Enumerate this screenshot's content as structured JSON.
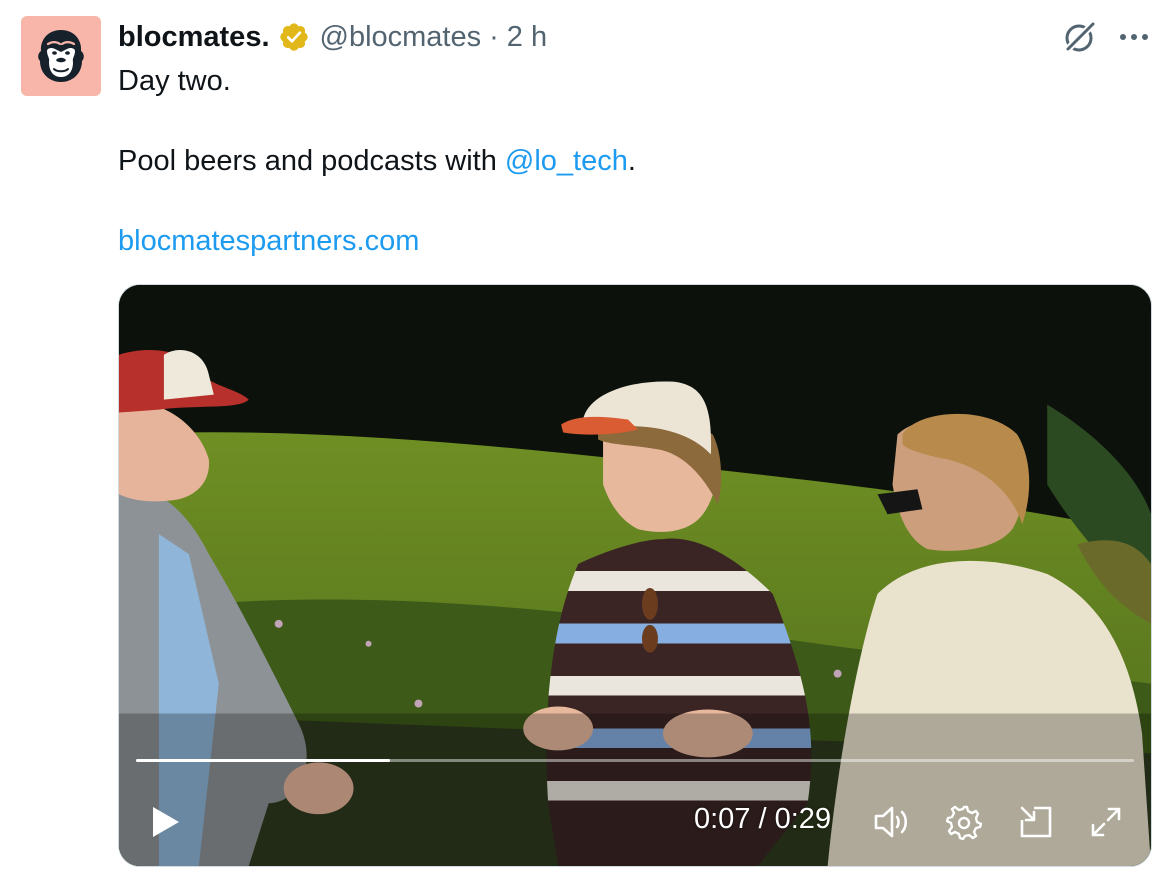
{
  "tweet": {
    "display_name": "blocmates.",
    "handle": "@blocmates",
    "separator": "·",
    "time": "2 h",
    "text_line1": "Day two.",
    "text_line2_prefix": "Pool beers and podcasts with ",
    "mention": "@lo_tech",
    "text_line2_suffix": ".",
    "link": "blocmatespartners.com"
  },
  "video": {
    "current_time": "0:07",
    "time_separator": " / ",
    "duration": "0:29",
    "progress_fraction": 0.255
  },
  "colors": {
    "link": "#1d9bf0",
    "avatar_bg": "#f7b6a9",
    "verified_badge": "#e2b719",
    "secondary_text": "#536471"
  },
  "icons": {
    "avatar": "gorilla-logo-icon",
    "verified": "verified-badge-icon",
    "grok": "grok-icon",
    "more": "more-dots-icon",
    "play": "play-icon",
    "volume": "volume-icon",
    "settings": "settings-gear-icon",
    "dock": "dock-icon",
    "fullscreen": "fullscreen-icon"
  }
}
